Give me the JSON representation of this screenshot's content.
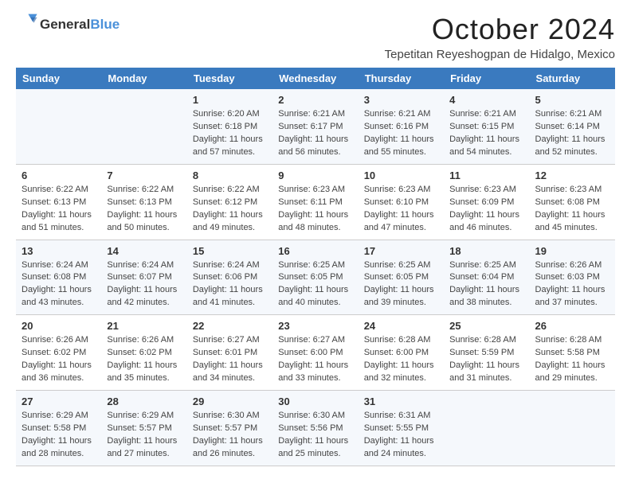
{
  "header": {
    "logo_line1": "General",
    "logo_line2": "Blue",
    "month_title": "October 2024",
    "location": "Tepetitan Reyeshogpan de Hidalgo, Mexico"
  },
  "days_of_week": [
    "Sunday",
    "Monday",
    "Tuesday",
    "Wednesday",
    "Thursday",
    "Friday",
    "Saturday"
  ],
  "weeks": [
    [
      {
        "day": "",
        "info": ""
      },
      {
        "day": "",
        "info": ""
      },
      {
        "day": "1",
        "info": "Sunrise: 6:20 AM\nSunset: 6:18 PM\nDaylight: 11 hours and 57 minutes."
      },
      {
        "day": "2",
        "info": "Sunrise: 6:21 AM\nSunset: 6:17 PM\nDaylight: 11 hours and 56 minutes."
      },
      {
        "day": "3",
        "info": "Sunrise: 6:21 AM\nSunset: 6:16 PM\nDaylight: 11 hours and 55 minutes."
      },
      {
        "day": "4",
        "info": "Sunrise: 6:21 AM\nSunset: 6:15 PM\nDaylight: 11 hours and 54 minutes."
      },
      {
        "day": "5",
        "info": "Sunrise: 6:21 AM\nSunset: 6:14 PM\nDaylight: 11 hours and 52 minutes."
      }
    ],
    [
      {
        "day": "6",
        "info": "Sunrise: 6:22 AM\nSunset: 6:13 PM\nDaylight: 11 hours and 51 minutes."
      },
      {
        "day": "7",
        "info": "Sunrise: 6:22 AM\nSunset: 6:13 PM\nDaylight: 11 hours and 50 minutes."
      },
      {
        "day": "8",
        "info": "Sunrise: 6:22 AM\nSunset: 6:12 PM\nDaylight: 11 hours and 49 minutes."
      },
      {
        "day": "9",
        "info": "Sunrise: 6:23 AM\nSunset: 6:11 PM\nDaylight: 11 hours and 48 minutes."
      },
      {
        "day": "10",
        "info": "Sunrise: 6:23 AM\nSunset: 6:10 PM\nDaylight: 11 hours and 47 minutes."
      },
      {
        "day": "11",
        "info": "Sunrise: 6:23 AM\nSunset: 6:09 PM\nDaylight: 11 hours and 46 minutes."
      },
      {
        "day": "12",
        "info": "Sunrise: 6:23 AM\nSunset: 6:08 PM\nDaylight: 11 hours and 45 minutes."
      }
    ],
    [
      {
        "day": "13",
        "info": "Sunrise: 6:24 AM\nSunset: 6:08 PM\nDaylight: 11 hours and 43 minutes."
      },
      {
        "day": "14",
        "info": "Sunrise: 6:24 AM\nSunset: 6:07 PM\nDaylight: 11 hours and 42 minutes."
      },
      {
        "day": "15",
        "info": "Sunrise: 6:24 AM\nSunset: 6:06 PM\nDaylight: 11 hours and 41 minutes."
      },
      {
        "day": "16",
        "info": "Sunrise: 6:25 AM\nSunset: 6:05 PM\nDaylight: 11 hours and 40 minutes."
      },
      {
        "day": "17",
        "info": "Sunrise: 6:25 AM\nSunset: 6:05 PM\nDaylight: 11 hours and 39 minutes."
      },
      {
        "day": "18",
        "info": "Sunrise: 6:25 AM\nSunset: 6:04 PM\nDaylight: 11 hours and 38 minutes."
      },
      {
        "day": "19",
        "info": "Sunrise: 6:26 AM\nSunset: 6:03 PM\nDaylight: 11 hours and 37 minutes."
      }
    ],
    [
      {
        "day": "20",
        "info": "Sunrise: 6:26 AM\nSunset: 6:02 PM\nDaylight: 11 hours and 36 minutes."
      },
      {
        "day": "21",
        "info": "Sunrise: 6:26 AM\nSunset: 6:02 PM\nDaylight: 11 hours and 35 minutes."
      },
      {
        "day": "22",
        "info": "Sunrise: 6:27 AM\nSunset: 6:01 PM\nDaylight: 11 hours and 34 minutes."
      },
      {
        "day": "23",
        "info": "Sunrise: 6:27 AM\nSunset: 6:00 PM\nDaylight: 11 hours and 33 minutes."
      },
      {
        "day": "24",
        "info": "Sunrise: 6:28 AM\nSunset: 6:00 PM\nDaylight: 11 hours and 32 minutes."
      },
      {
        "day": "25",
        "info": "Sunrise: 6:28 AM\nSunset: 5:59 PM\nDaylight: 11 hours and 31 minutes."
      },
      {
        "day": "26",
        "info": "Sunrise: 6:28 AM\nSunset: 5:58 PM\nDaylight: 11 hours and 29 minutes."
      }
    ],
    [
      {
        "day": "27",
        "info": "Sunrise: 6:29 AM\nSunset: 5:58 PM\nDaylight: 11 hours and 28 minutes."
      },
      {
        "day": "28",
        "info": "Sunrise: 6:29 AM\nSunset: 5:57 PM\nDaylight: 11 hours and 27 minutes."
      },
      {
        "day": "29",
        "info": "Sunrise: 6:30 AM\nSunset: 5:57 PM\nDaylight: 11 hours and 26 minutes."
      },
      {
        "day": "30",
        "info": "Sunrise: 6:30 AM\nSunset: 5:56 PM\nDaylight: 11 hours and 25 minutes."
      },
      {
        "day": "31",
        "info": "Sunrise: 6:31 AM\nSunset: 5:55 PM\nDaylight: 11 hours and 24 minutes."
      },
      {
        "day": "",
        "info": ""
      },
      {
        "day": "",
        "info": ""
      }
    ]
  ]
}
